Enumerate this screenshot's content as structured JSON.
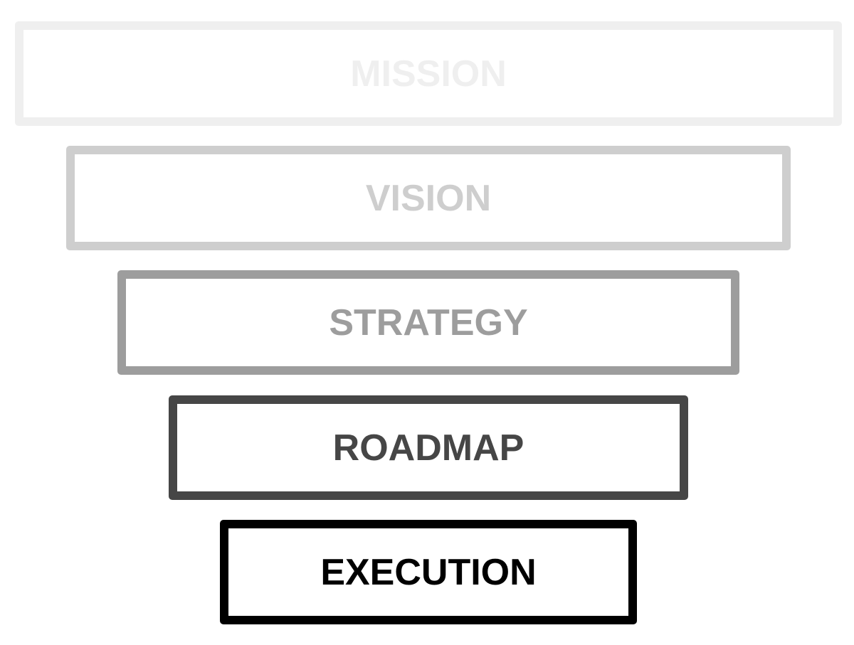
{
  "diagram": {
    "tiers": [
      {
        "label": "MISSION",
        "color": "#efefef"
      },
      {
        "label": "VISION",
        "color": "#cecece"
      },
      {
        "label": "STRATEGY",
        "color": "#9d9d9d"
      },
      {
        "label": "ROADMAP",
        "color": "#464646"
      },
      {
        "label": "EXECUTION",
        "color": "#000000"
      }
    ]
  }
}
